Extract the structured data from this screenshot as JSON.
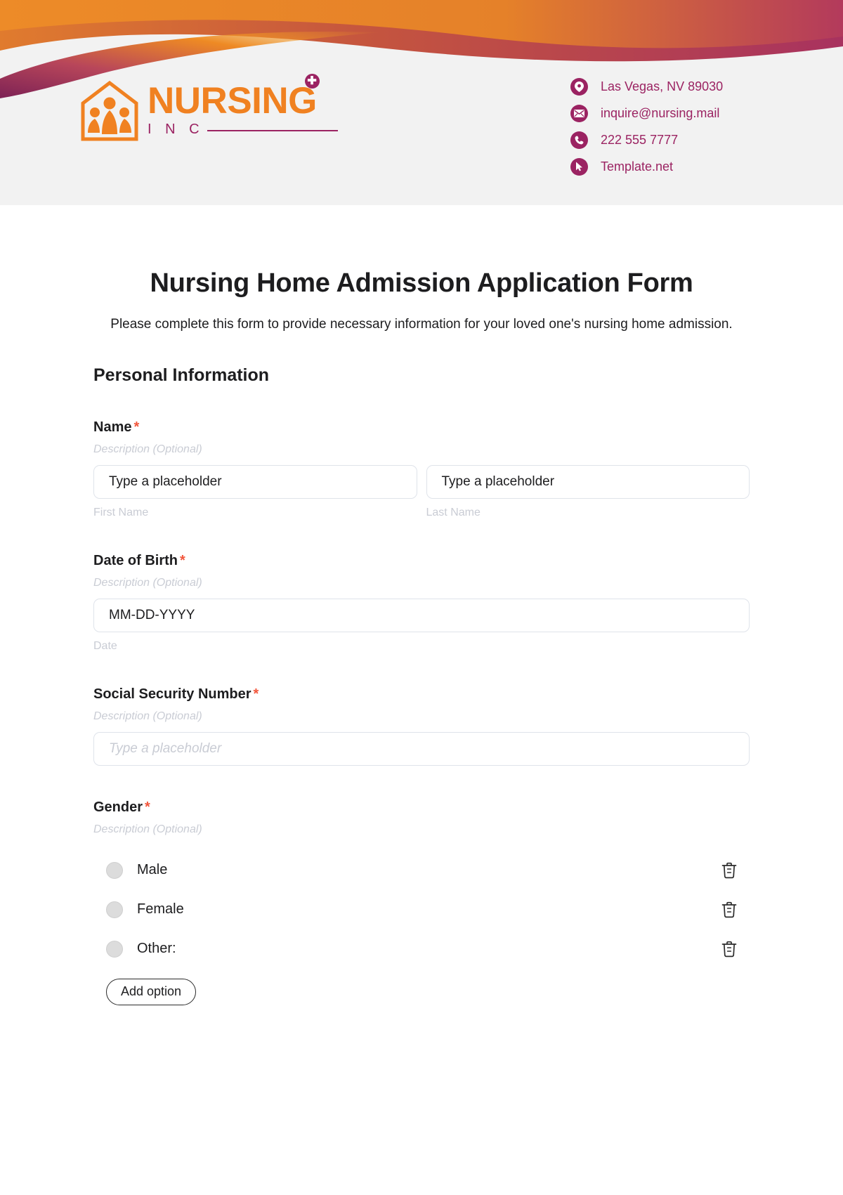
{
  "brand": {
    "logo_word": "NURSING",
    "logo_sub": "I N C",
    "cross_glyph": "✚",
    "orange": "#F08121",
    "magenta": "#9B2362"
  },
  "header": {
    "contacts": [
      {
        "icon": "location-pin-icon",
        "text": "Las Vegas, NV 89030"
      },
      {
        "icon": "envelope-icon",
        "text": "inquire@nursing.mail"
      },
      {
        "icon": "phone-icon",
        "text": "222 555 7777"
      },
      {
        "icon": "cursor-arrow-icon",
        "text": "Template.net"
      }
    ]
  },
  "form": {
    "title": "Nursing Home Admission Application Form",
    "subtitle": "Please complete this form to provide necessary information for your loved one's nursing home admission.",
    "section_title": "Personal Information",
    "required_marker": "*",
    "description_placeholder": "Description (Optional)",
    "fields": {
      "name": {
        "label": "Name",
        "description": "Description (Optional)",
        "first_value": "Type a placeholder",
        "last_value": "Type a placeholder",
        "first_sublabel": "First Name",
        "last_sublabel": "Last Name"
      },
      "dob": {
        "label": "Date of Birth",
        "description": "Description (Optional)",
        "value": "MM-DD-YYYY",
        "sublabel": "Date"
      },
      "ssn": {
        "label": "Social Security Number",
        "description": "Description (Optional)",
        "placeholder": "Type a placeholder"
      },
      "gender": {
        "label": "Gender",
        "description": "Description (Optional)",
        "options": [
          "Male",
          "Female",
          "Other:"
        ],
        "add_option_label": "Add option"
      }
    }
  }
}
